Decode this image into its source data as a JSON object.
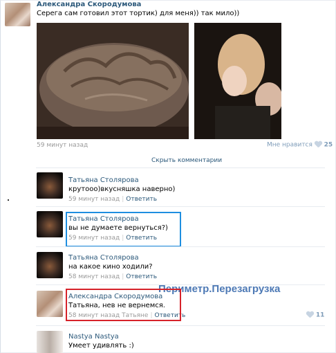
{
  "post": {
    "author": "Александра Скородумова",
    "text": "Серега сам готовил этот тортик) для меня)) так мило))",
    "time": "59 минут назад",
    "like_label": "Мне нравится",
    "like_count": "25"
  },
  "comments_toggle": "Скрыть комментарии",
  "comments": [
    {
      "author": "Татьяна Столярова",
      "text": "крутооо)вкусняшка наверно)",
      "time": "59 минут назад",
      "reply": "Ответить"
    },
    {
      "author": "Татьяна Столярова",
      "text": "вы не думаете вернуться?)",
      "time": "59 минут назад",
      "reply": "Ответить"
    },
    {
      "author": "Татьяна Столярова",
      "text": "на какое кино ходили?",
      "time": "58 минут назад",
      "reply": "Ответить"
    },
    {
      "author": "Александра Скородумова",
      "text": "Татьяна, нев не вернемся.",
      "time": "58 минут назад",
      "to": "Татьяне",
      "reply": "Ответить",
      "like_count": "11"
    },
    {
      "author": "Nastya Nastya",
      "text": "Умеет удивлять :)"
    }
  ],
  "watermark": "Периметр.Перезагрузка",
  "colors": {
    "link": "#2b587a",
    "meta": "#999999",
    "blue_box": "#1e8ee0",
    "red_box": "#d6222a",
    "watermark": "#4d79b5"
  },
  "icons": {
    "like": "heart-icon"
  }
}
